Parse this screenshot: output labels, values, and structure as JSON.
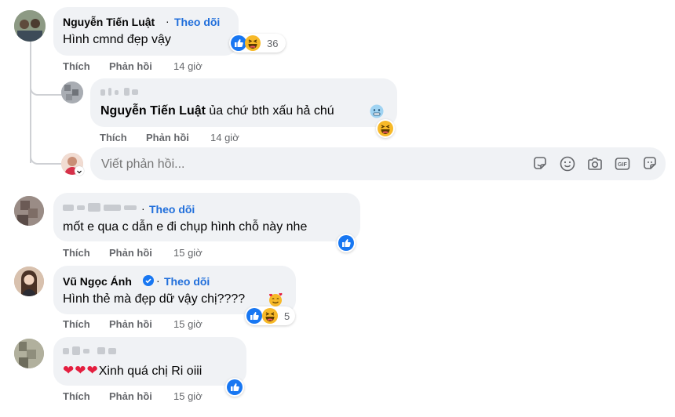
{
  "actions": {
    "like": "Thích",
    "reply": "Phản hồi"
  },
  "follow_label": "Theo dõi",
  "comments": [
    {
      "author": "Nguyễn Tiến Luật",
      "text": "Hình cmnd đẹp vậy",
      "time": "14 giờ",
      "reaction_count": "36"
    },
    {
      "author_hidden": true,
      "mention": "Nguyễn Tiến Luật",
      "text": "ủa chứ bth xấu hả chú",
      "time": "14 giờ"
    },
    {
      "author_hidden": true,
      "text": "mốt e qua c dẫn e đi chụp hình chỗ này nhe",
      "time": "15 giờ"
    },
    {
      "author": "Vũ Ngọc Ánh",
      "verified": true,
      "text": "Hình thẻ mà đẹp dữ vậy chị????",
      "time": "15 giờ",
      "reaction_count": "5"
    },
    {
      "author_hidden": true,
      "text": "Xinh quá chị Ri oiii",
      "hearts": "❤❤❤",
      "time": "15 giờ"
    }
  ],
  "reply_box": {
    "placeholder": "Viết phản hồi..."
  },
  "icons": [
    "like-reaction-icon",
    "haha-reaction-icon",
    "cold-face-emoji-icon",
    "smiling-hearts-emoji-icon",
    "sticker-icon",
    "emoji-icon",
    "camera-icon",
    "gif-icon",
    "avatar-sticker-icon",
    "verified-badge-icon"
  ],
  "colors": {
    "link_blue": "#216fdb",
    "bubble_gray": "#f0f2f5",
    "secondary_text": "#65676b",
    "like_blue": "#1877f2",
    "haha_yellow": "#f7b928",
    "heart_red": "#e41e3f"
  }
}
